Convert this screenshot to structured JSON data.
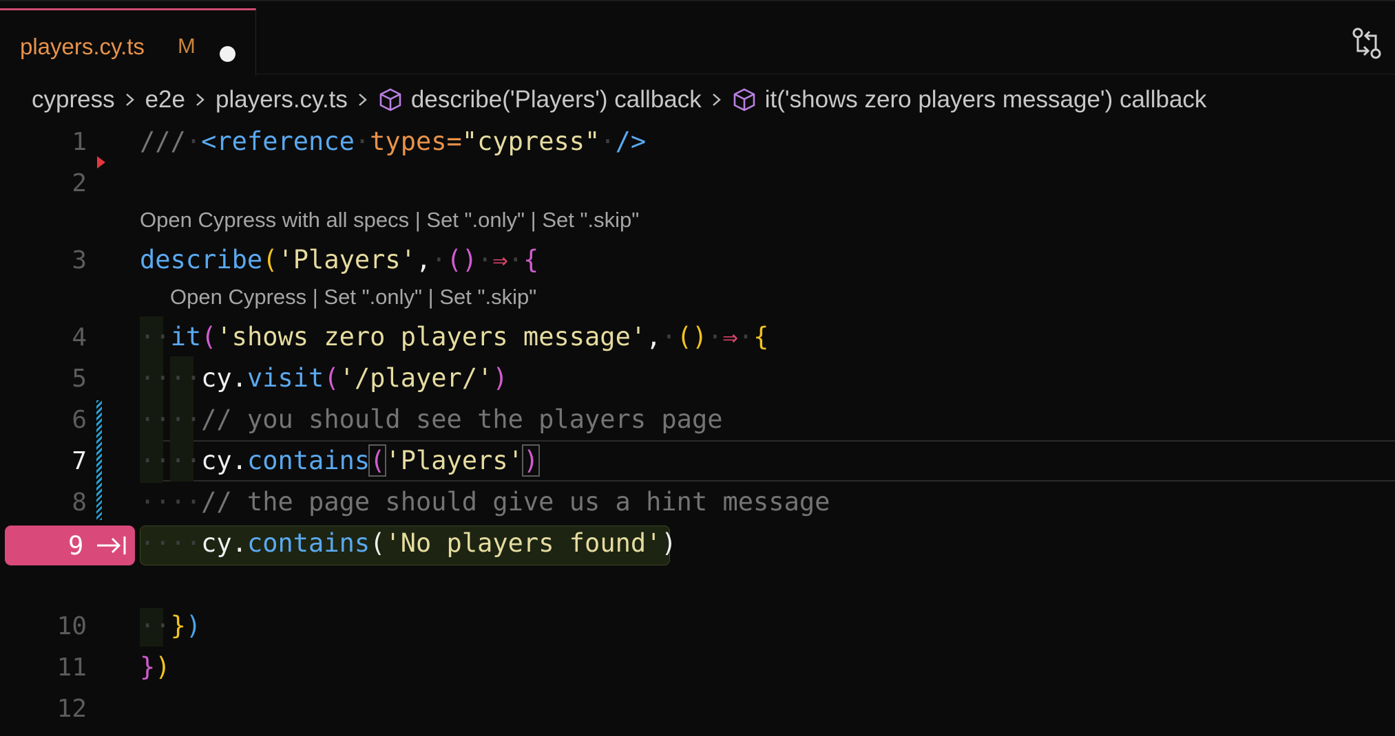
{
  "tab": {
    "title": "players.cy.ts",
    "status": "M"
  },
  "toolbar": {
    "compare_icon": "git-compare-icon"
  },
  "breadcrumb": {
    "items": [
      "cypress",
      "e2e",
      "players.cy.ts",
      "describe('Players') callback",
      "it('shows zero players message') callback"
    ]
  },
  "codelens": {
    "describe": [
      "Open Cypress with all specs",
      "Set \".only\"",
      "Set \".skip\""
    ],
    "it": [
      "Open Cypress",
      "Set \".only\"",
      "Set \".skip\""
    ],
    "separator": " | "
  },
  "line_numbers": [
    "1",
    "2",
    "3",
    "4",
    "5",
    "6",
    "7",
    "8",
    "9",
    "10",
    "11",
    "12"
  ],
  "code": {
    "l1": {
      "slashes": "///",
      "open": "<reference",
      "attr": "types",
      "eq": "=",
      "val": "\"cypress\"",
      "close": "/>"
    },
    "l3": {
      "fn": "describe",
      "str": "'Players'",
      "comma": ",",
      "arrow": "⇒"
    },
    "l4": {
      "fn": "it",
      "str": "'shows zero players message'",
      "comma": ",",
      "arrow": "⇒"
    },
    "l5": {
      "obj": "cy",
      "method": "visit",
      "str": "'/player/'"
    },
    "l6": {
      "comment": "// you should see the players page"
    },
    "l7": {
      "obj": "cy",
      "method": "contains",
      "str": "'Players'"
    },
    "l8": {
      "comment": "// the page should give us a hint message"
    },
    "l9": {
      "obj": "cy",
      "method": "contains",
      "str": "'No players found'"
    }
  },
  "current_line": "7",
  "debug_line": "9",
  "colors": {
    "accent": "#d94a7a",
    "tab_title": "#e8924a",
    "string": "#e6dca0",
    "keyword": "#5aa9f0"
  }
}
